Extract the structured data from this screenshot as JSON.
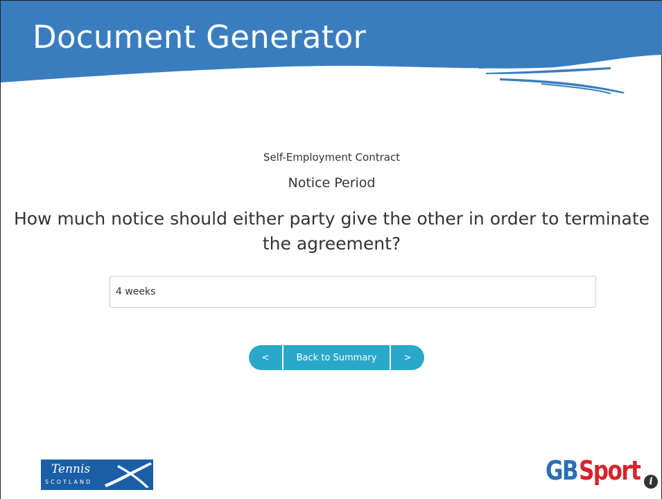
{
  "header": {
    "title": "Document Generator"
  },
  "document": {
    "type": "Self-Employment Contract",
    "section": "Notice Period"
  },
  "question": {
    "text": "How much notice should either party give the other in order to terminate the agreement?",
    "answer_value": "4 weeks"
  },
  "navigation": {
    "prev_label": "<",
    "summary_label": "Back to Summary",
    "next_label": ">"
  },
  "footer": {
    "tennis_logo_word": "Tennis",
    "tennis_logo_sub": "SCOTLAND",
    "gbsport_gb": "GB",
    "gbsport_sport": "Sport",
    "info_glyph": "i"
  },
  "colors": {
    "banner": "#3a7dbf",
    "accent_button": "#2aa8c9",
    "tennis_blue": "#1a5fa6",
    "gb_blue": "#2a6fb5",
    "sport_red": "#d6242a"
  },
  "icons": {
    "info": "info-icon",
    "tennis_cross": "saltire-swoosh-icon"
  }
}
